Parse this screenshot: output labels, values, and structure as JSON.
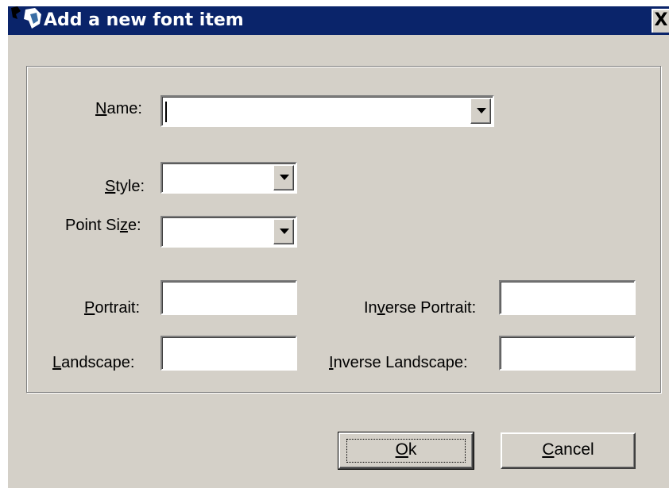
{
  "window": {
    "title": "Add a new font item",
    "close_glyph": "X",
    "icon": "app-icon"
  },
  "form": {
    "name_label_accel": "N",
    "name_label_rest": "ame:",
    "name_value": "",
    "style_label_accel": "S",
    "style_label_rest": "tyle:",
    "style_value": "",
    "point_size_label_pre": "Point Si",
    "point_size_label_accel": "z",
    "point_size_label_post": "e:",
    "point_size_value": "",
    "portrait_label_accel": "P",
    "portrait_label_rest": "ortrait:",
    "portrait_value": "",
    "landscape_label_accel": "L",
    "landscape_label_rest": "andscape:",
    "landscape_value": "",
    "inverse_portrait_label_pre": "In",
    "inverse_portrait_label_accel": "v",
    "inverse_portrait_label_post": "erse Portrait:",
    "inverse_portrait_value": "",
    "inverse_landscape_label_accel": "I",
    "inverse_landscape_label_rest": "nverse Landscape:",
    "inverse_landscape_value": ""
  },
  "buttons": {
    "ok_accel": "O",
    "ok_rest": "k",
    "cancel_accel": "C",
    "cancel_rest": "ancel"
  },
  "colors": {
    "titlebar": "#0a246a",
    "face": "#d4d0c8"
  }
}
